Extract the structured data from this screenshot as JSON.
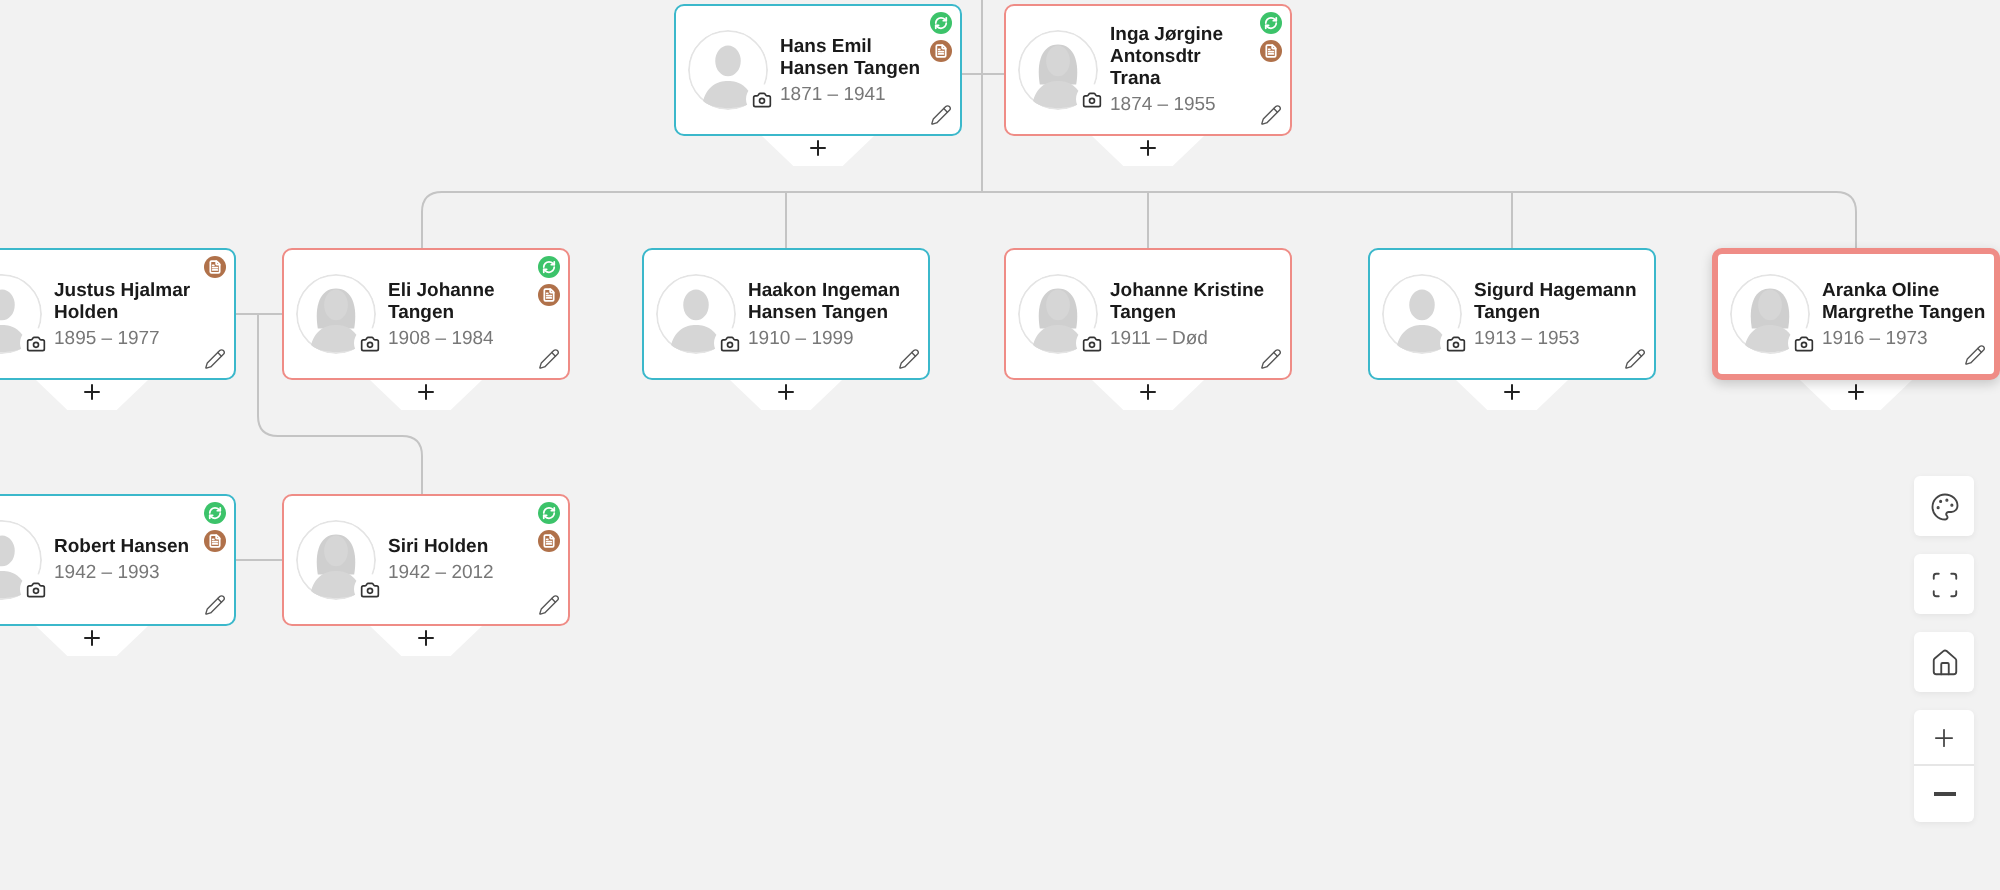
{
  "generations": [
    {
      "people": [
        {
          "name": "Hans Emil Hansen Tangen",
          "years": "1871 – 1941",
          "kind": "male",
          "selected": false,
          "synced": true,
          "has_document": true
        },
        {
          "name": "Inga Jørgine Antonsdtr Trana",
          "years": "1874 – 1955",
          "kind": "female",
          "selected": false,
          "synced": true,
          "has_document": true
        }
      ]
    },
    {
      "people": [
        {
          "name": "Justus Hjalmar Holden",
          "years": "1895 – 1977",
          "kind": "male",
          "selected": false,
          "synced": false,
          "has_document": true
        },
        {
          "name": "Eli Johanne Tangen",
          "years": "1908 – 1984",
          "kind": "female",
          "selected": false,
          "synced": true,
          "has_document": true
        },
        {
          "name": "Haakon Ingeman Hansen Tangen",
          "years": "1910 – 1999",
          "kind": "male",
          "selected": false,
          "synced": false,
          "has_document": false
        },
        {
          "name": "Johanne Kristine Tangen",
          "years": "1911 – Død",
          "kind": "female",
          "selected": false,
          "synced": false,
          "has_document": false
        },
        {
          "name": "Sigurd Hagemann Tangen",
          "years": "1913 – 1953",
          "kind": "male",
          "selected": false,
          "synced": false,
          "has_document": false
        },
        {
          "name": "Aranka Oline Margrethe Tangen",
          "years": "1916 – 1973",
          "kind": "female",
          "selected": true,
          "synced": false,
          "has_document": false
        }
      ]
    },
    {
      "people": [
        {
          "name": "Robert Hansen",
          "years": "1942 – 1993",
          "kind": "male",
          "selected": false,
          "synced": true,
          "has_document": true
        },
        {
          "name": "Siri Holden",
          "years": "1942 – 2012",
          "kind": "female",
          "selected": false,
          "synced": true,
          "has_document": true
        }
      ]
    }
  ]
}
